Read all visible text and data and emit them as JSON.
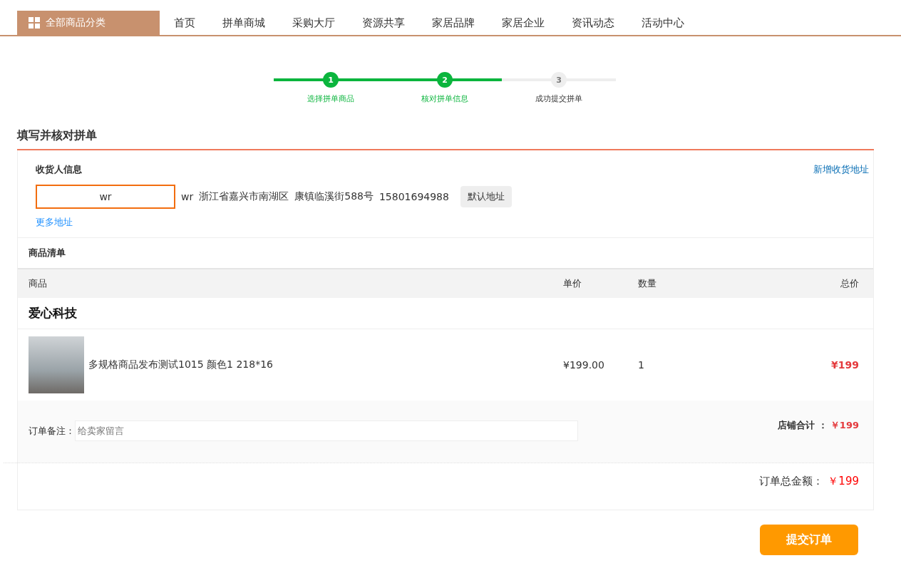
{
  "nav": {
    "category_button": "全部商品分类",
    "items": [
      "首页",
      "拼单商城",
      "采购大厅",
      "资源共享",
      "家居品牌",
      "家居企业",
      "资讯动态",
      "活动中心"
    ]
  },
  "steps": [
    {
      "number": "1",
      "label": "选择拼单商品",
      "done": true
    },
    {
      "number": "2",
      "label": "核对拼单信息",
      "done": true
    },
    {
      "number": "3",
      "label": "成功提交拼单",
      "done": false
    }
  ],
  "page_title": "填写并核对拼单",
  "consignee": {
    "title": "收货人信息",
    "add_link": "新增收货地址",
    "more_link": "更多地址",
    "addresses": [
      {
        "tag": "wr",
        "selected": true,
        "name": "wr",
        "region": "浙江省嘉兴市南湖区",
        "street": "康镇临溪街588号",
        "phone": "15801694988",
        "default_label": "默认地址"
      }
    ]
  },
  "goods": {
    "title": "商品清单",
    "columns": [
      "商品",
      "单价",
      "数量",
      "总价"
    ],
    "shop": "爱心科技",
    "rows": [
      {
        "name": "多规格商品发布测试1015 颜色1 218*16",
        "price": "¥199.00",
        "quantity": "1",
        "total": "¥199"
      }
    ],
    "remark_label": "订单备注：",
    "remark_placeholder": "给卖家留言",
    "shop_total_label": "店铺合计 ：",
    "shop_total": "￥199"
  },
  "order_total_label": "订单总金额：",
  "order_total": "￥199",
  "submit_button": "提交订单"
}
